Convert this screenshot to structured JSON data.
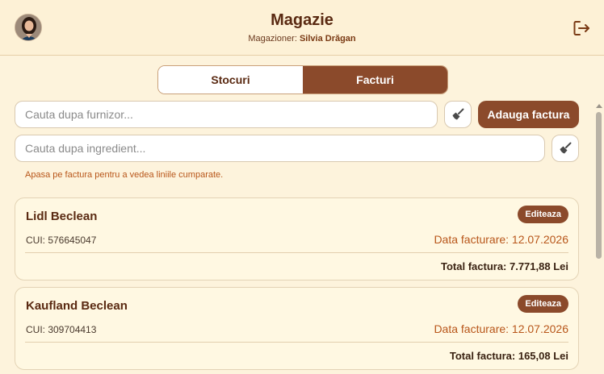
{
  "header": {
    "title": "Magazie",
    "role_label": "Magazioner:",
    "user_name": "Silvia Drăgan"
  },
  "tabs": [
    {
      "label": "Stocuri",
      "active": false
    },
    {
      "label": "Facturi",
      "active": true
    }
  ],
  "search": {
    "supplier_placeholder": "Cauta dupa furnizor...",
    "supplier_value": "",
    "ingredient_placeholder": "Cauta dupa ingredient...",
    "ingredient_value": ""
  },
  "actions": {
    "add_invoice_label": "Adauga factura"
  },
  "hint": "Apasa pe factura pentru a vedea liniile cumparate.",
  "invoices": [
    {
      "supplier": "Lidl Beclean",
      "edit_label": "Editeaza",
      "cui": "CUI: 576645047",
      "date": "Data facturare: 12.07.2026",
      "total": "Total factura: 7.771,88 Lei"
    },
    {
      "supplier": "Kaufland Beclean",
      "edit_label": "Editeaza",
      "cui": "CUI: 309704413",
      "date": "Data facturare: 12.07.2026",
      "total": "Total factura: 165,08 Lei"
    }
  ],
  "colors": {
    "accent": "#8b4a2b",
    "background": "#fdf3dc",
    "card": "#fff8e2",
    "highlight": "#b8561a"
  }
}
